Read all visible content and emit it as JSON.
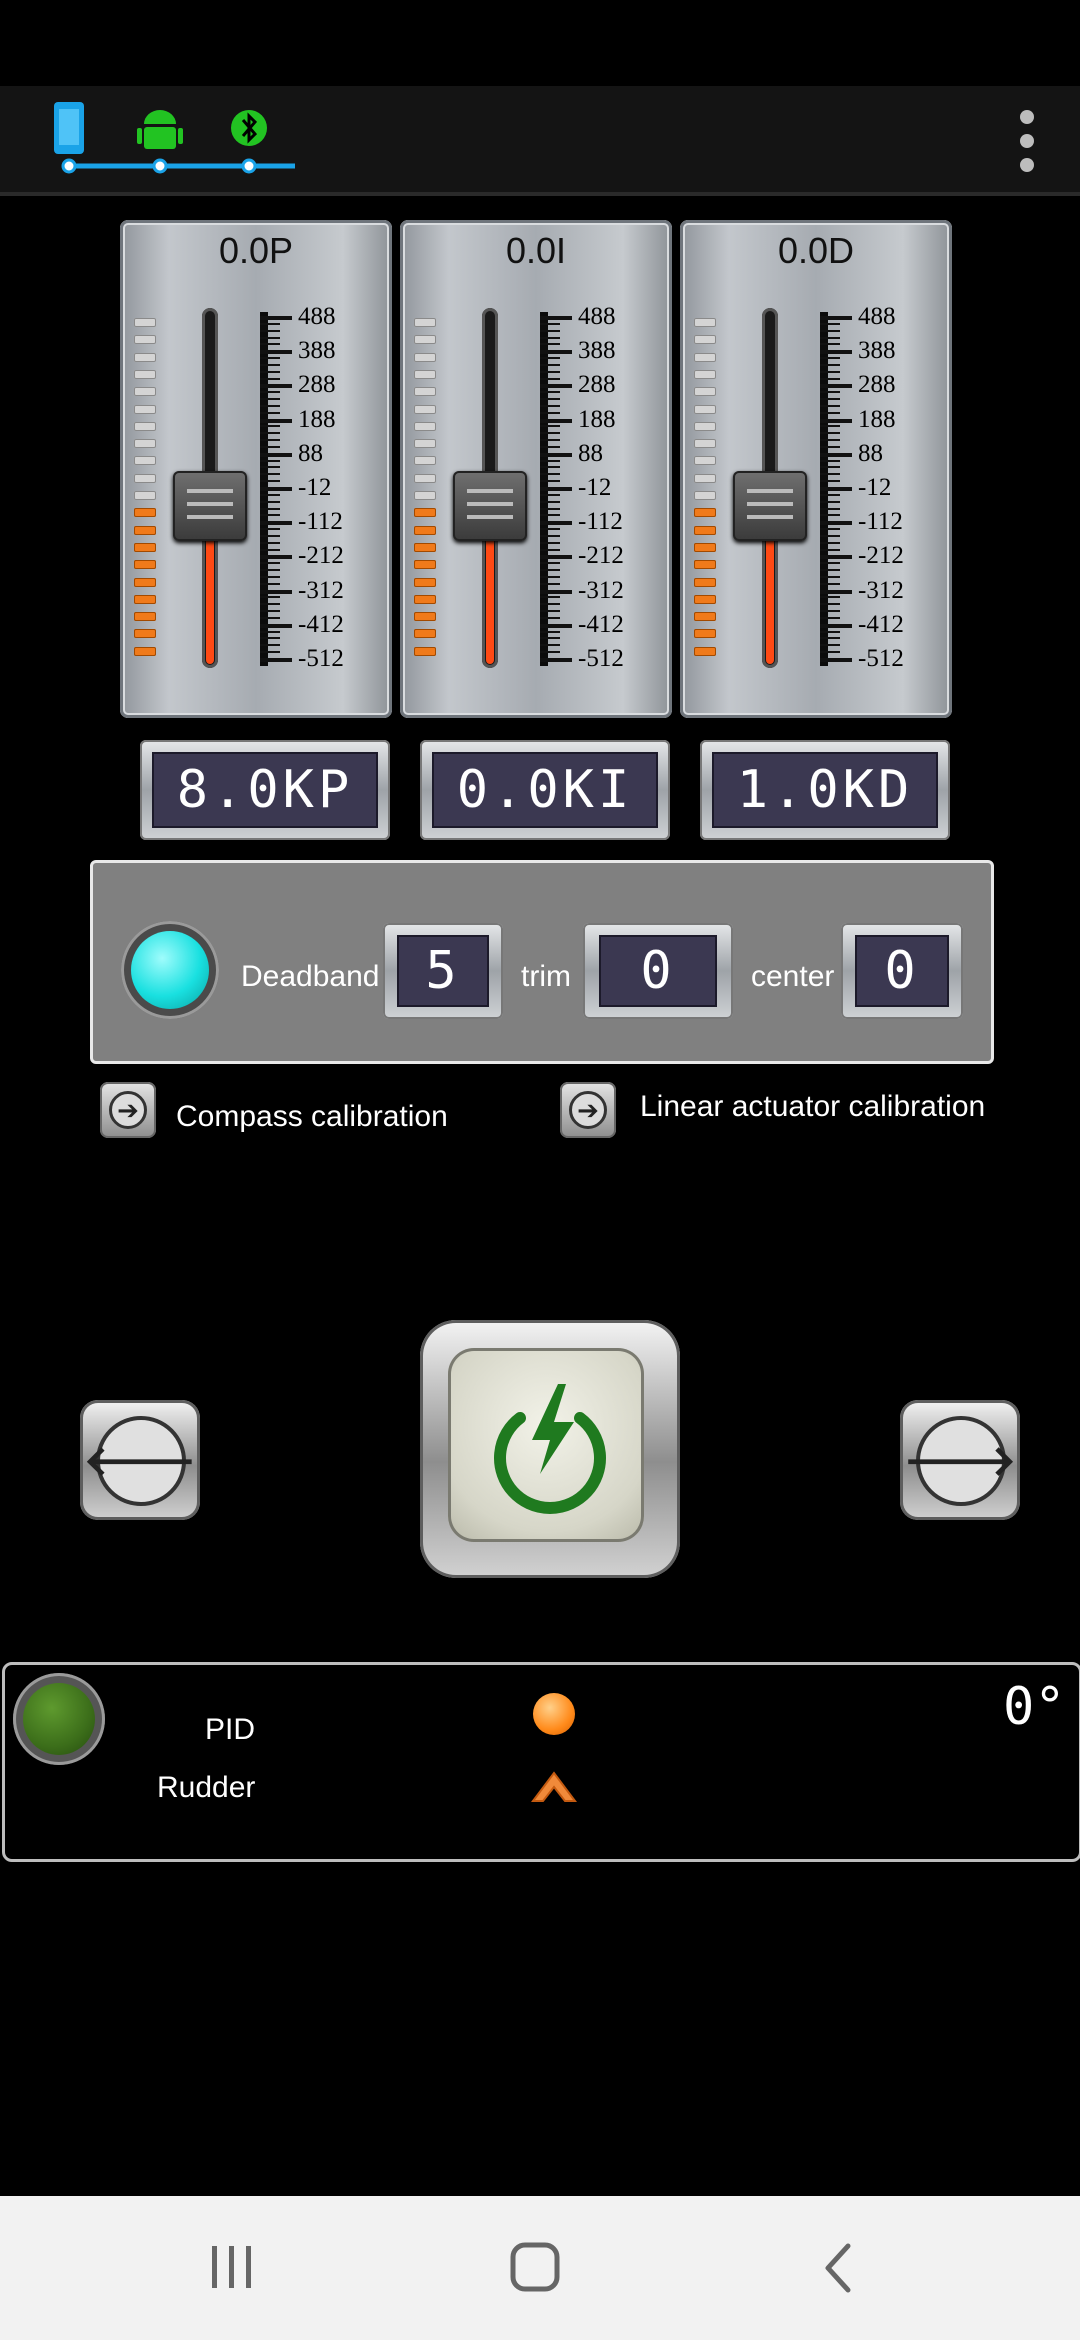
{
  "app_bar": {
    "connection_icons": [
      "phone-icon",
      "android-icon",
      "bluetooth-icon"
    ],
    "menu_icon": "overflow-menu-icon"
  },
  "faders": [
    {
      "title": "0.0P",
      "level": 0.45,
      "scale": [
        "488",
        "388",
        "288",
        "188",
        "88",
        "-12",
        "-112",
        "-212",
        "-312",
        "-412",
        "-512"
      ],
      "lcd": "8.0KP"
    },
    {
      "title": "0.0I",
      "level": 0.45,
      "scale": [
        "488",
        "388",
        "288",
        "188",
        "88",
        "-12",
        "-112",
        "-212",
        "-312",
        "-412",
        "-512"
      ],
      "lcd": "0.0KI"
    },
    {
      "title": "0.0D",
      "level": 0.45,
      "scale": [
        "488",
        "388",
        "288",
        "188",
        "88",
        "-12",
        "-112",
        "-212",
        "-312",
        "-412",
        "-512"
      ],
      "lcd": "1.0KD"
    }
  ],
  "settings": {
    "indicator_color": "#19e0e0",
    "deadband_label": "Deadband",
    "deadband_value": "5",
    "trim_label": "trim",
    "trim_value": "0",
    "center_label": "center",
    "center_value": "0"
  },
  "calibration": {
    "compass_label": "Compass calibration",
    "linear_label": "Linear actuator calibration"
  },
  "controls": {
    "left_icon": "arrow-left-icon",
    "power_icon": "power-icon",
    "right_icon": "arrow-right-icon",
    "power_color": "#1f7a1f"
  },
  "status": {
    "led_color": "#3c6e1a",
    "pid_label": "PID",
    "rudder_label": "Rudder",
    "pid_indicator_color": "#ff8a1a",
    "heading": "0°"
  },
  "navbar": {
    "recent_icon": "recent-apps-icon",
    "home_icon": "home-icon",
    "back_icon": "back-icon"
  },
  "colors": {
    "accent_green": "#22c322",
    "accent_blue": "#1aa3e8",
    "fader_fill": "#ff4a14"
  }
}
